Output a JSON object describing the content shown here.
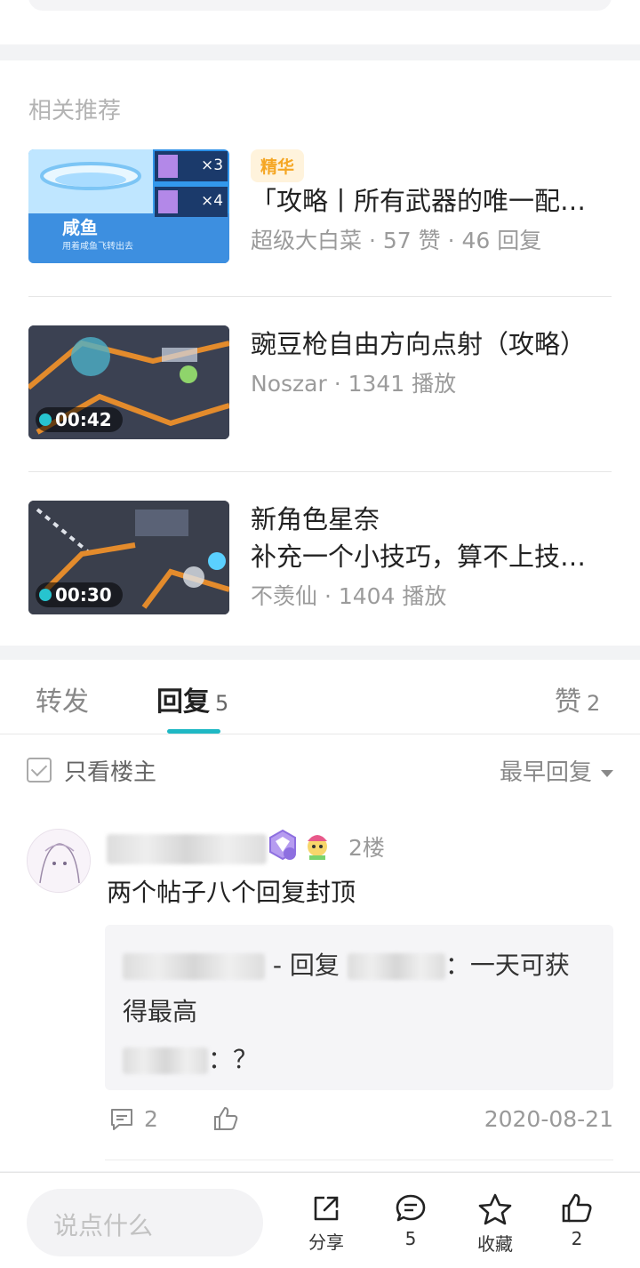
{
  "related": {
    "title": "相关推荐",
    "items": [
      {
        "badge": "精华",
        "title": "「攻略丨所有武器的唯一配…",
        "author": "超级大白菜",
        "meta": "57 赞 · 46 回复",
        "thumb_caption": "咸鱼",
        "thumb_sub": "用着咸鱼飞转出去",
        "thumb_x1": "×3",
        "thumb_x2": "×4"
      },
      {
        "title": "豌豆枪自由方向点射（攻略）",
        "author": "Noszar",
        "meta": "1341 播放",
        "duration": "00:42"
      },
      {
        "title": "新角色星奈",
        "subtitle": "补充一个小技巧，算不上技…",
        "author": "不羡仙",
        "meta": "1404 播放",
        "duration": "00:30"
      }
    ]
  },
  "tabs": {
    "forward": "转发",
    "reply": "回复",
    "reply_count": "5",
    "like": "赞",
    "like_count": "2"
  },
  "filter": {
    "only_owner": "只看楼主",
    "sort": "最早回复"
  },
  "comment": {
    "floor": "2楼",
    "text": "两个帖子八个回复封顶",
    "reply_lines": [
      {
        "prefix": "- 回复",
        "text": "：一天可获"
      },
      {
        "text": "得最高"
      },
      {
        "text": "：？"
      }
    ],
    "reply_count": "2",
    "date": "2020-08-21"
  },
  "bottom": {
    "input_placeholder": "说点什么",
    "share": "分享",
    "comments": "5",
    "favorite": "收藏",
    "likes": "2"
  }
}
